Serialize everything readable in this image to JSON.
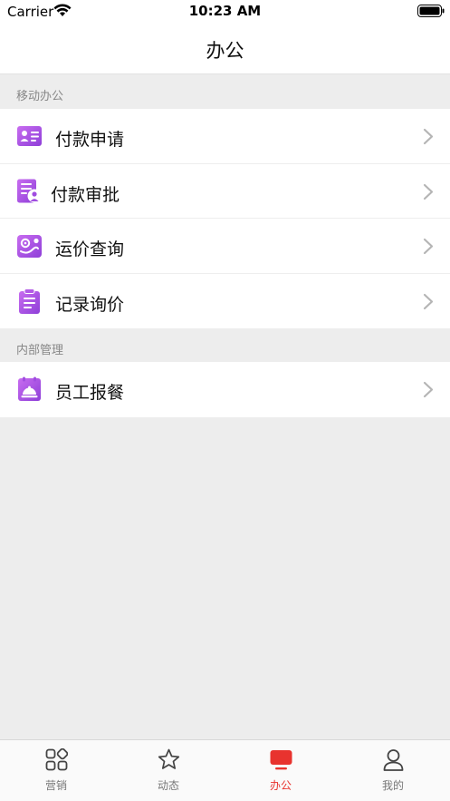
{
  "status_bar": {
    "carrier": "Carrier",
    "time": "10:23 AM"
  },
  "nav": {
    "title": "办公"
  },
  "sections": [
    {
      "header": "移动办公",
      "items": [
        {
          "label": "付款申请",
          "icon": "id-card-icon"
        },
        {
          "label": "付款审批",
          "icon": "document-user-icon"
        },
        {
          "label": "运价查询",
          "icon": "route-map-icon"
        },
        {
          "label": "记录询价",
          "icon": "clipboard-icon"
        }
      ]
    },
    {
      "header": "内部管理",
      "items": [
        {
          "label": "员工报餐",
          "icon": "meal-cloche-icon"
        }
      ]
    }
  ],
  "tab_bar": {
    "tabs": [
      {
        "label": "营销",
        "icon": "grid-apps-icon",
        "active": false
      },
      {
        "label": "动态",
        "icon": "star-icon",
        "active": false
      },
      {
        "label": "办公",
        "icon": "monitor-icon",
        "active": true
      },
      {
        "label": "我的",
        "icon": "person-icon",
        "active": false
      }
    ]
  },
  "colors": {
    "accent": "#e8332e",
    "icon_gradient_start": "#c86cf0",
    "icon_gradient_end": "#8e3fd8",
    "background": "#ededed"
  }
}
